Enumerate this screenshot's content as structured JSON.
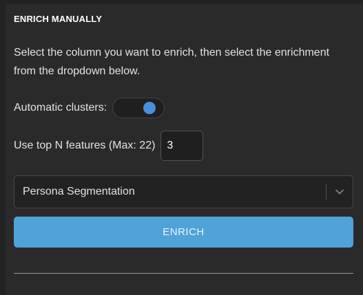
{
  "section": {
    "title": "ENRICH MANUALLY",
    "description": "Select the column you want to enrich, then select the enrichment from the dropdown below."
  },
  "clusters": {
    "label": "Automatic clusters:",
    "toggle_on": true,
    "accent_color": "#4a8fdc"
  },
  "features": {
    "label": "Use top N features (Max: 22)",
    "value": "3"
  },
  "enrichment_select": {
    "selected": "Persona Segmentation",
    "icon": "chevron-down-icon"
  },
  "actions": {
    "enrich_label": "ENRICH",
    "button_color": "#4fa3d9"
  }
}
